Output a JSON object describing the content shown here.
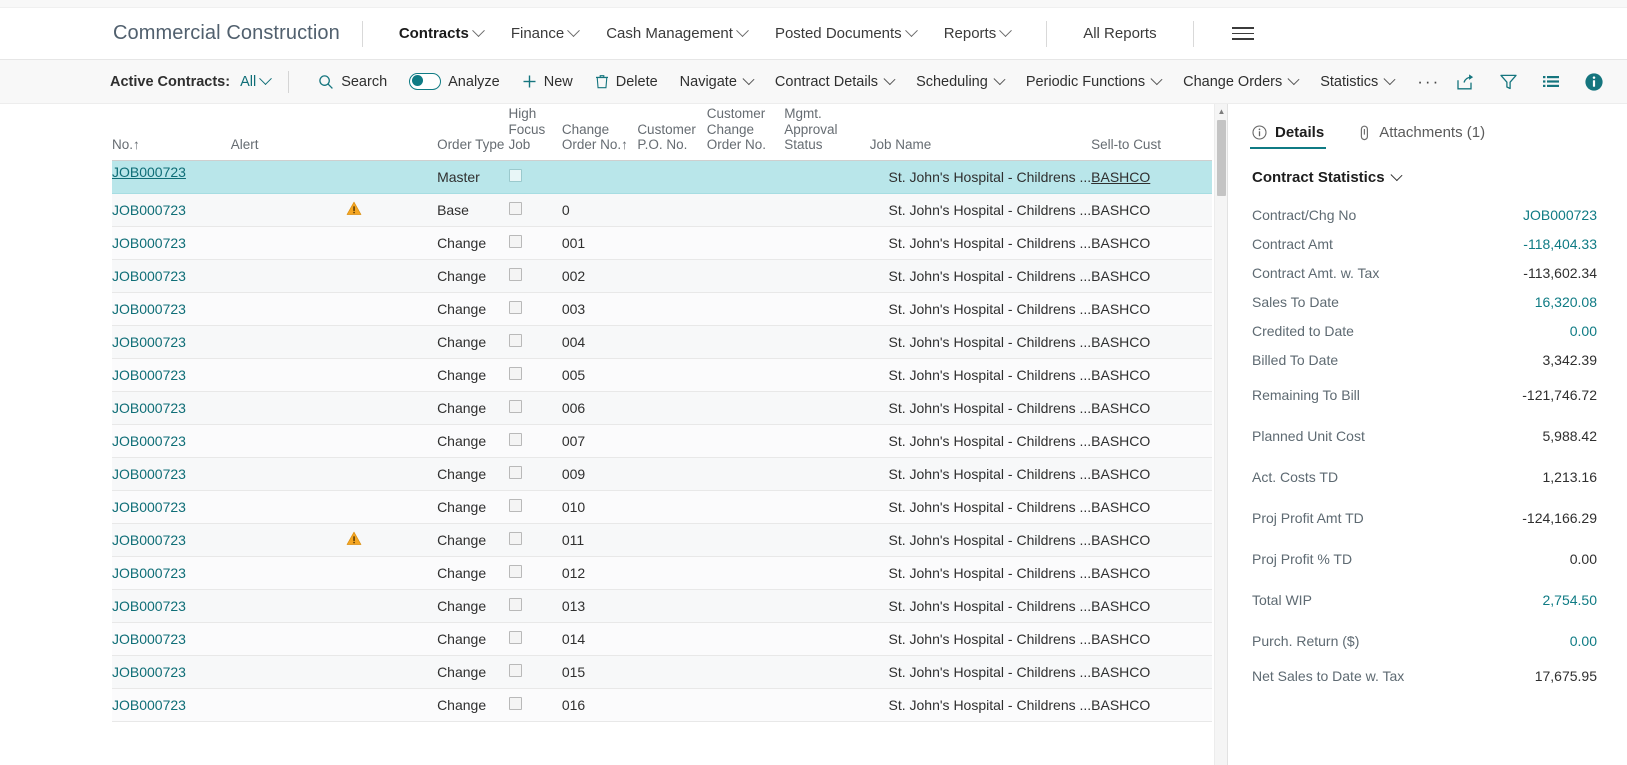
{
  "header": {
    "company": "Commercial Construction",
    "nav_items": [
      {
        "label": "Contracts",
        "has_caret": true,
        "active": true
      },
      {
        "label": "Finance",
        "has_caret": true,
        "active": false
      },
      {
        "label": "Cash Management",
        "has_caret": true,
        "active": false
      },
      {
        "label": "Posted Documents",
        "has_caret": true,
        "active": false
      },
      {
        "label": "Reports",
        "has_caret": true,
        "active": false
      },
      {
        "label": "All Reports",
        "has_caret": false,
        "active": false
      }
    ],
    "menu_icon": "hamburger-menu-icon"
  },
  "toolbar": {
    "filter_label": "Active Contracts:",
    "filter_value": "All",
    "search_label": "Search",
    "analyze_label": "Analyze",
    "analyze_on": true,
    "new_label": "New",
    "delete_label": "Delete",
    "navigate_label": "Navigate",
    "contract_details_label": "Contract Details",
    "scheduling_label": "Scheduling",
    "periodic_functions_label": "Periodic Functions",
    "change_orders_label": "Change Orders",
    "statistics_label": "Statistics",
    "overflow_label": "···",
    "icons": [
      "share-icon",
      "filter-icon",
      "list-view-icon",
      "info-icon",
      "expand-icon"
    ]
  },
  "table": {
    "columns": [
      {
        "key": "no",
        "label": "No.",
        "sort": "↑"
      },
      {
        "key": "alert",
        "label": "Alert",
        "sort": ""
      },
      {
        "key": "order_type",
        "label": "Order Type",
        "sort": ""
      },
      {
        "key": "high_focus_job",
        "label": "High\nFocus\nJob",
        "sort": ""
      },
      {
        "key": "change_order_no",
        "label": "Change\nOrder No.",
        "sort": "↑"
      },
      {
        "key": "customer_po_no",
        "label": "Customer\nP.O. No.",
        "sort": ""
      },
      {
        "key": "customer_change_order_no",
        "label": "Customer\nChange\nOrder No.",
        "sort": ""
      },
      {
        "key": "mgmt_approval_status",
        "label": "Mgmt.\nApproval\nStatus",
        "sort": ""
      },
      {
        "key": "job_name",
        "label": "Job Name",
        "sort": ""
      },
      {
        "key": "sell_to_cust",
        "label": "Sell-to Cust",
        "sort": ""
      }
    ],
    "rows": [
      {
        "no": "JOB000723",
        "alert": "",
        "order_type": "Master",
        "high_focus_job": false,
        "change_order_no": "",
        "customer_po_no": "",
        "customer_change_order_no": "",
        "mgmt_approval_status": "",
        "job_name": "St. John's Hospital - Childrens ...",
        "sell_to_cust": "BASHCO",
        "selected": true,
        "menu": true
      },
      {
        "no": "JOB000723",
        "alert": "warning-icon",
        "order_type": "Base",
        "high_focus_job": false,
        "change_order_no": "0",
        "customer_po_no": "",
        "customer_change_order_no": "",
        "mgmt_approval_status": "",
        "job_name": "St. John's Hospital - Childrens ...",
        "sell_to_cust": "BASHCO",
        "selected": false,
        "menu": false
      },
      {
        "no": "JOB000723",
        "alert": "",
        "order_type": "Change",
        "high_focus_job": false,
        "change_order_no": "001",
        "customer_po_no": "",
        "customer_change_order_no": "",
        "mgmt_approval_status": "",
        "job_name": "St. John's Hospital - Childrens ...",
        "sell_to_cust": "BASHCO",
        "selected": false,
        "menu": false
      },
      {
        "no": "JOB000723",
        "alert": "",
        "order_type": "Change",
        "high_focus_job": false,
        "change_order_no": "002",
        "customer_po_no": "",
        "customer_change_order_no": "",
        "mgmt_approval_status": "",
        "job_name": "St. John's Hospital - Childrens ...",
        "sell_to_cust": "BASHCO",
        "selected": false,
        "menu": false
      },
      {
        "no": "JOB000723",
        "alert": "",
        "order_type": "Change",
        "high_focus_job": false,
        "change_order_no": "003",
        "customer_po_no": "",
        "customer_change_order_no": "",
        "mgmt_approval_status": "",
        "job_name": "St. John's Hospital - Childrens ...",
        "sell_to_cust": "BASHCO",
        "selected": false,
        "menu": false
      },
      {
        "no": "JOB000723",
        "alert": "",
        "order_type": "Change",
        "high_focus_job": false,
        "change_order_no": "004",
        "customer_po_no": "",
        "customer_change_order_no": "",
        "mgmt_approval_status": "",
        "job_name": "St. John's Hospital - Childrens ...",
        "sell_to_cust": "BASHCO",
        "selected": false,
        "menu": false
      },
      {
        "no": "JOB000723",
        "alert": "",
        "order_type": "Change",
        "high_focus_job": false,
        "change_order_no": "005",
        "customer_po_no": "",
        "customer_change_order_no": "",
        "mgmt_approval_status": "",
        "job_name": "St. John's Hospital - Childrens ...",
        "sell_to_cust": "BASHCO",
        "selected": false,
        "menu": false
      },
      {
        "no": "JOB000723",
        "alert": "",
        "order_type": "Change",
        "high_focus_job": false,
        "change_order_no": "006",
        "customer_po_no": "",
        "customer_change_order_no": "",
        "mgmt_approval_status": "",
        "job_name": "St. John's Hospital - Childrens ...",
        "sell_to_cust": "BASHCO",
        "selected": false,
        "menu": false
      },
      {
        "no": "JOB000723",
        "alert": "",
        "order_type": "Change",
        "high_focus_job": false,
        "change_order_no": "007",
        "customer_po_no": "",
        "customer_change_order_no": "",
        "mgmt_approval_status": "",
        "job_name": "St. John's Hospital - Childrens ...",
        "sell_to_cust": "BASHCO",
        "selected": false,
        "menu": false
      },
      {
        "no": "JOB000723",
        "alert": "",
        "order_type": "Change",
        "high_focus_job": false,
        "change_order_no": "009",
        "customer_po_no": "",
        "customer_change_order_no": "",
        "mgmt_approval_status": "",
        "job_name": "St. John's Hospital - Childrens ...",
        "sell_to_cust": "BASHCO",
        "selected": false,
        "menu": false
      },
      {
        "no": "JOB000723",
        "alert": "",
        "order_type": "Change",
        "high_focus_job": false,
        "change_order_no": "010",
        "customer_po_no": "",
        "customer_change_order_no": "",
        "mgmt_approval_status": "",
        "job_name": "St. John's Hospital - Childrens ...",
        "sell_to_cust": "BASHCO",
        "selected": false,
        "menu": false
      },
      {
        "no": "JOB000723",
        "alert": "warning-icon",
        "order_type": "Change",
        "high_focus_job": false,
        "change_order_no": "011",
        "customer_po_no": "",
        "customer_change_order_no": "",
        "mgmt_approval_status": "",
        "job_name": "St. John's Hospital - Childrens ...",
        "sell_to_cust": "BASHCO",
        "selected": false,
        "menu": false
      },
      {
        "no": "JOB000723",
        "alert": "",
        "order_type": "Change",
        "high_focus_job": false,
        "change_order_no": "012",
        "customer_po_no": "",
        "customer_change_order_no": "",
        "mgmt_approval_status": "",
        "job_name": "St. John's Hospital - Childrens ...",
        "sell_to_cust": "BASHCO",
        "selected": false,
        "menu": false
      },
      {
        "no": "JOB000723",
        "alert": "",
        "order_type": "Change",
        "high_focus_job": false,
        "change_order_no": "013",
        "customer_po_no": "",
        "customer_change_order_no": "",
        "mgmt_approval_status": "",
        "job_name": "St. John's Hospital - Childrens ...",
        "sell_to_cust": "BASHCO",
        "selected": false,
        "menu": false
      },
      {
        "no": "JOB000723",
        "alert": "",
        "order_type": "Change",
        "high_focus_job": false,
        "change_order_no": "014",
        "customer_po_no": "",
        "customer_change_order_no": "",
        "mgmt_approval_status": "",
        "job_name": "St. John's Hospital - Childrens ...",
        "sell_to_cust": "BASHCO",
        "selected": false,
        "menu": false
      },
      {
        "no": "JOB000723",
        "alert": "",
        "order_type": "Change",
        "high_focus_job": false,
        "change_order_no": "015",
        "customer_po_no": "",
        "customer_change_order_no": "",
        "mgmt_approval_status": "",
        "job_name": "St. John's Hospital - Childrens ...",
        "sell_to_cust": "BASHCO",
        "selected": false,
        "menu": false
      },
      {
        "no": "JOB000723",
        "alert": "",
        "order_type": "Change",
        "high_focus_job": false,
        "change_order_no": "016",
        "customer_po_no": "",
        "customer_change_order_no": "",
        "mgmt_approval_status": "",
        "job_name": "St. John's Hospital - Childrens ...",
        "sell_to_cust": "BASHCO",
        "selected": false,
        "menu": false
      }
    ]
  },
  "fact_pane": {
    "tabs": [
      {
        "label": "Details",
        "icon": "info-circle-icon",
        "active": true
      },
      {
        "label": "Attachments (1)",
        "icon": "paperclip-icon",
        "active": false
      }
    ],
    "section_title": "Contract Statistics",
    "stats": [
      {
        "key": "Contract/Chg No",
        "value": "JOB000723",
        "link": true,
        "gap": "tight"
      },
      {
        "key": "Contract Amt",
        "value": "-118,404.33",
        "link": true,
        "gap": "tight"
      },
      {
        "key": "Contract Amt. w. Tax",
        "value": "-113,602.34",
        "link": false,
        "gap": "tight"
      },
      {
        "key": "Sales To Date",
        "value": "16,320.08",
        "link": true,
        "gap": "tight"
      },
      {
        "key": "Credited to Date",
        "value": "0.00",
        "link": true,
        "gap": "tight"
      },
      {
        "key": "Billed To Date",
        "value": "3,342.39",
        "link": false,
        "gap": "tight"
      },
      {
        "key": "Remaining To Bill",
        "value": "-121,746.72",
        "link": false,
        "gap": "loose"
      },
      {
        "key": "Planned Unit Cost",
        "value": "5,988.42",
        "link": false,
        "gap": "loose"
      },
      {
        "key": "Act. Costs TD",
        "value": "1,213.16",
        "link": false,
        "gap": "loose"
      },
      {
        "key": "Proj Profit Amt TD",
        "value": "-124,166.29",
        "link": false,
        "gap": "loose"
      },
      {
        "key": "Proj Profit % TD",
        "value": "0.00",
        "link": false,
        "gap": "loose"
      },
      {
        "key": "Total WIP",
        "value": "2,754.50",
        "link": true,
        "gap": "loose"
      },
      {
        "key": "Purch. Return ($)",
        "value": "0.00",
        "link": true,
        "gap": "loose"
      },
      {
        "key": "Net Sales to Date w. Tax",
        "value": "17,675.95",
        "link": false,
        "gap": "tight"
      }
    ]
  },
  "colors": {
    "accent": "#0f7b84",
    "link": "#0f6e77",
    "selected_row": "#b9e6ea",
    "warning": "#f5a623"
  }
}
